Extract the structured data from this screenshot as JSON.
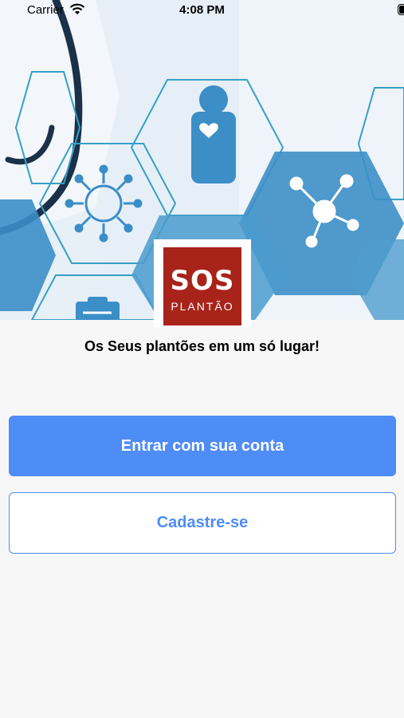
{
  "status_bar": {
    "carrier": "Carrier",
    "time": "4:08 PM",
    "icons": [
      "wifi-icon",
      "battery-icon"
    ]
  },
  "hero": {
    "description_icons": [
      "doctor-with-stethoscope-image",
      "person-heart-icon",
      "virus-icon",
      "molecule-icon",
      "clipboard-icon"
    ]
  },
  "logo": {
    "text": "SOS PLANTÃO",
    "colors": {
      "background": "#a8231a",
      "text": "#ffffff"
    }
  },
  "tagline": "Os Seus plantões em um só lugar!",
  "actions": {
    "login_label": "Entrar com sua conta",
    "signup_label": "Cadastre-se"
  },
  "colors": {
    "accent": "#4e8cf6",
    "page_background": "#f7f7f8"
  }
}
